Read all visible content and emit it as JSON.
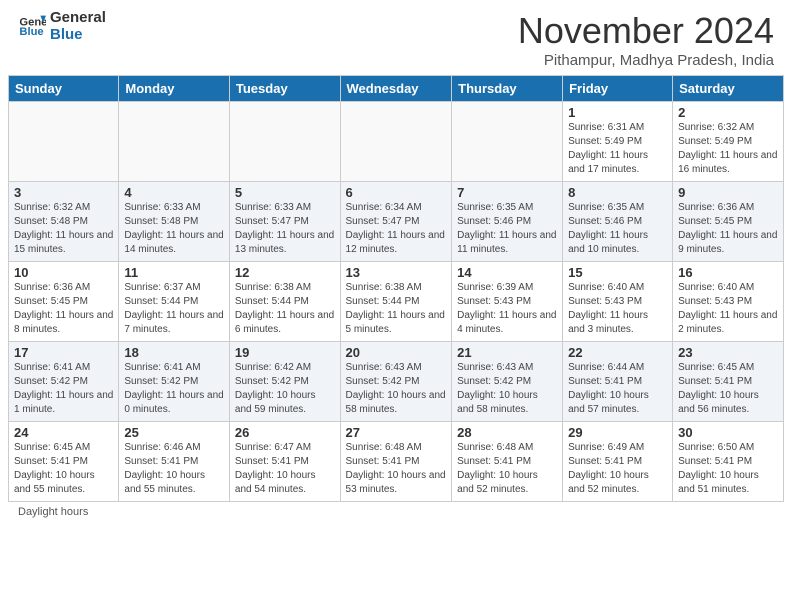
{
  "header": {
    "logo_general": "General",
    "logo_blue": "Blue",
    "month_title": "November 2024",
    "subtitle": "Pithampur, Madhya Pradesh, India"
  },
  "weekdays": [
    "Sunday",
    "Monday",
    "Tuesday",
    "Wednesday",
    "Thursday",
    "Friday",
    "Saturday"
  ],
  "weeks": [
    [
      {
        "day": "",
        "info": ""
      },
      {
        "day": "",
        "info": ""
      },
      {
        "day": "",
        "info": ""
      },
      {
        "day": "",
        "info": ""
      },
      {
        "day": "",
        "info": ""
      },
      {
        "day": "1",
        "info": "Sunrise: 6:31 AM\nSunset: 5:49 PM\nDaylight: 11 hours and 17 minutes."
      },
      {
        "day": "2",
        "info": "Sunrise: 6:32 AM\nSunset: 5:49 PM\nDaylight: 11 hours and 16 minutes."
      }
    ],
    [
      {
        "day": "3",
        "info": "Sunrise: 6:32 AM\nSunset: 5:48 PM\nDaylight: 11 hours and 15 minutes."
      },
      {
        "day": "4",
        "info": "Sunrise: 6:33 AM\nSunset: 5:48 PM\nDaylight: 11 hours and 14 minutes."
      },
      {
        "day": "5",
        "info": "Sunrise: 6:33 AM\nSunset: 5:47 PM\nDaylight: 11 hours and 13 minutes."
      },
      {
        "day": "6",
        "info": "Sunrise: 6:34 AM\nSunset: 5:47 PM\nDaylight: 11 hours and 12 minutes."
      },
      {
        "day": "7",
        "info": "Sunrise: 6:35 AM\nSunset: 5:46 PM\nDaylight: 11 hours and 11 minutes."
      },
      {
        "day": "8",
        "info": "Sunrise: 6:35 AM\nSunset: 5:46 PM\nDaylight: 11 hours and 10 minutes."
      },
      {
        "day": "9",
        "info": "Sunrise: 6:36 AM\nSunset: 5:45 PM\nDaylight: 11 hours and 9 minutes."
      }
    ],
    [
      {
        "day": "10",
        "info": "Sunrise: 6:36 AM\nSunset: 5:45 PM\nDaylight: 11 hours and 8 minutes."
      },
      {
        "day": "11",
        "info": "Sunrise: 6:37 AM\nSunset: 5:44 PM\nDaylight: 11 hours and 7 minutes."
      },
      {
        "day": "12",
        "info": "Sunrise: 6:38 AM\nSunset: 5:44 PM\nDaylight: 11 hours and 6 minutes."
      },
      {
        "day": "13",
        "info": "Sunrise: 6:38 AM\nSunset: 5:44 PM\nDaylight: 11 hours and 5 minutes."
      },
      {
        "day": "14",
        "info": "Sunrise: 6:39 AM\nSunset: 5:43 PM\nDaylight: 11 hours and 4 minutes."
      },
      {
        "day": "15",
        "info": "Sunrise: 6:40 AM\nSunset: 5:43 PM\nDaylight: 11 hours and 3 minutes."
      },
      {
        "day": "16",
        "info": "Sunrise: 6:40 AM\nSunset: 5:43 PM\nDaylight: 11 hours and 2 minutes."
      }
    ],
    [
      {
        "day": "17",
        "info": "Sunrise: 6:41 AM\nSunset: 5:42 PM\nDaylight: 11 hours and 1 minute."
      },
      {
        "day": "18",
        "info": "Sunrise: 6:41 AM\nSunset: 5:42 PM\nDaylight: 11 hours and 0 minutes."
      },
      {
        "day": "19",
        "info": "Sunrise: 6:42 AM\nSunset: 5:42 PM\nDaylight: 10 hours and 59 minutes."
      },
      {
        "day": "20",
        "info": "Sunrise: 6:43 AM\nSunset: 5:42 PM\nDaylight: 10 hours and 58 minutes."
      },
      {
        "day": "21",
        "info": "Sunrise: 6:43 AM\nSunset: 5:42 PM\nDaylight: 10 hours and 58 minutes."
      },
      {
        "day": "22",
        "info": "Sunrise: 6:44 AM\nSunset: 5:41 PM\nDaylight: 10 hours and 57 minutes."
      },
      {
        "day": "23",
        "info": "Sunrise: 6:45 AM\nSunset: 5:41 PM\nDaylight: 10 hours and 56 minutes."
      }
    ],
    [
      {
        "day": "24",
        "info": "Sunrise: 6:45 AM\nSunset: 5:41 PM\nDaylight: 10 hours and 55 minutes."
      },
      {
        "day": "25",
        "info": "Sunrise: 6:46 AM\nSunset: 5:41 PM\nDaylight: 10 hours and 55 minutes."
      },
      {
        "day": "26",
        "info": "Sunrise: 6:47 AM\nSunset: 5:41 PM\nDaylight: 10 hours and 54 minutes."
      },
      {
        "day": "27",
        "info": "Sunrise: 6:48 AM\nSunset: 5:41 PM\nDaylight: 10 hours and 53 minutes."
      },
      {
        "day": "28",
        "info": "Sunrise: 6:48 AM\nSunset: 5:41 PM\nDaylight: 10 hours and 52 minutes."
      },
      {
        "day": "29",
        "info": "Sunrise: 6:49 AM\nSunset: 5:41 PM\nDaylight: 10 hours and 52 minutes."
      },
      {
        "day": "30",
        "info": "Sunrise: 6:50 AM\nSunset: 5:41 PM\nDaylight: 10 hours and 51 minutes."
      }
    ]
  ],
  "footer": {
    "daylight_label": "Daylight hours"
  }
}
